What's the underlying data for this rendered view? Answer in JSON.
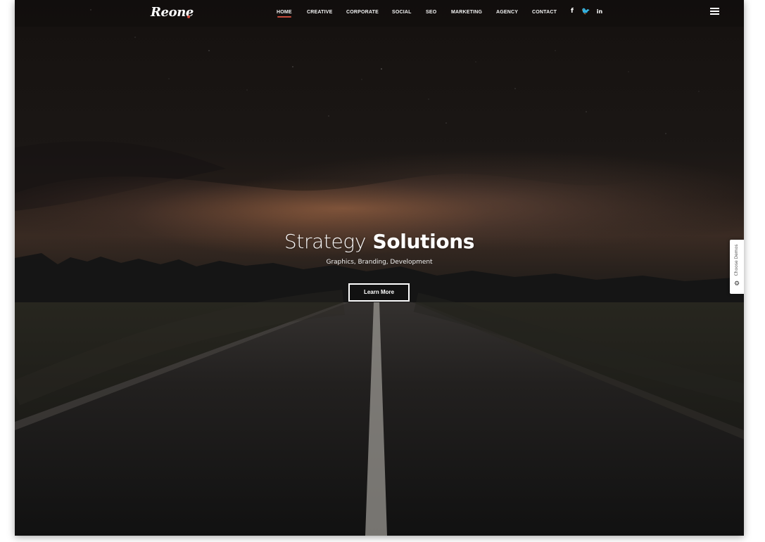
{
  "brand": {
    "name": "Reone"
  },
  "navigation": {
    "items": [
      {
        "label": "HOME"
      },
      {
        "label": "CREATIVE"
      },
      {
        "label": "CORPORATE"
      },
      {
        "label": "SOCIAL"
      },
      {
        "label": "SEO"
      },
      {
        "label": "MARKETING"
      },
      {
        "label": "AGENCY"
      },
      {
        "label": "CONTACT"
      }
    ],
    "active": "HOME",
    "social": [
      {
        "icon": "facebook-icon",
        "glyph": "f"
      },
      {
        "icon": "twitter-icon",
        "glyph": "🐦"
      },
      {
        "icon": "linkedin-icon",
        "glyph": "in"
      }
    ]
  },
  "hero": {
    "title_light": "Strategy",
    "title_bold": "Solutions",
    "subtitle": "Graphics, Branding, Development",
    "button": "Learn More"
  },
  "side_panel": {
    "label": "Choose Demos",
    "icon": "gear-icon",
    "icon_glyph": "⚙"
  },
  "colors": {
    "accent": "#c84b3c",
    "text": "#ffffff",
    "background": "#151312",
    "panel": "#ffffff"
  }
}
